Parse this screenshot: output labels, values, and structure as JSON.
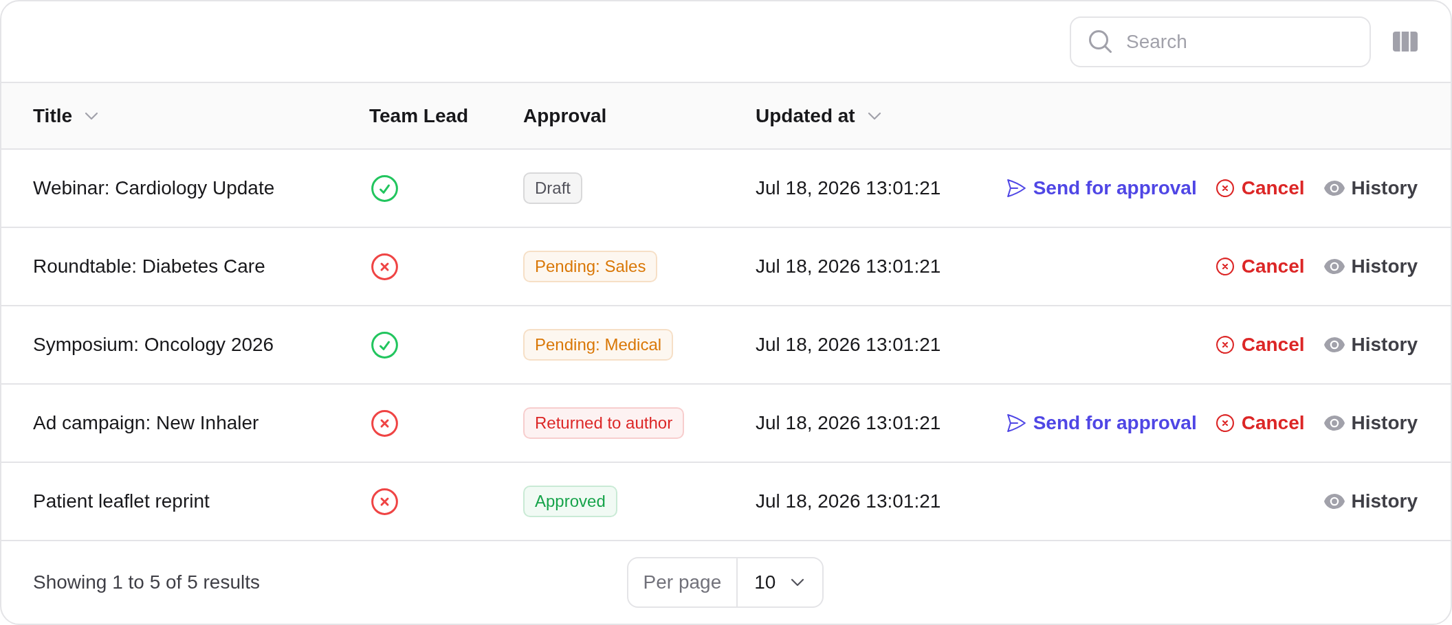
{
  "toolbar": {
    "search": {
      "placeholder": "Search"
    }
  },
  "table": {
    "columns": [
      {
        "label": "Title",
        "sortable": true
      },
      {
        "label": "Team Lead",
        "sortable": false
      },
      {
        "label": "Approval",
        "sortable": false
      },
      {
        "label": "Updated at",
        "sortable": true
      }
    ],
    "rows": [
      {
        "title": "Webinar: Cardiology Update",
        "team_lead_ok": true,
        "approval": {
          "label": "Draft",
          "color": "#52525b"
        },
        "updated_at": "Jul 18, 2026 13:01:21",
        "actions": [
          {
            "kind": "send",
            "label": "Send for approval"
          },
          {
            "kind": "cancel",
            "label": "Cancel"
          },
          {
            "kind": "history",
            "label": "History"
          }
        ]
      },
      {
        "title": "Roundtable: Diabetes Care",
        "team_lead_ok": false,
        "approval": {
          "label": "Pending: Sales",
          "color": "#d97706"
        },
        "updated_at": "Jul 18, 2026 13:01:21",
        "actions": [
          {
            "kind": "cancel",
            "label": "Cancel"
          },
          {
            "kind": "history",
            "label": "History"
          }
        ]
      },
      {
        "title": "Symposium: Oncology 2026",
        "team_lead_ok": true,
        "approval": {
          "label": "Pending: Medical",
          "color": "#d97706"
        },
        "updated_at": "Jul 18, 2026 13:01:21",
        "actions": [
          {
            "kind": "cancel",
            "label": "Cancel"
          },
          {
            "kind": "history",
            "label": "History"
          }
        ]
      },
      {
        "title": "Ad campaign: New Inhaler",
        "team_lead_ok": false,
        "approval": {
          "label": "Returned to author",
          "color": "#dc2626"
        },
        "updated_at": "Jul 18, 2026 13:01:21",
        "actions": [
          {
            "kind": "send",
            "label": "Send for approval"
          },
          {
            "kind": "cancel",
            "label": "Cancel"
          },
          {
            "kind": "history",
            "label": "History"
          }
        ]
      },
      {
        "title": "Patient leaflet reprint",
        "team_lead_ok": false,
        "approval": {
          "label": "Approved",
          "color": "#16a34a"
        },
        "updated_at": "Jul 18, 2026 13:01:21",
        "actions": [
          {
            "kind": "history",
            "label": "History"
          }
        ]
      }
    ]
  },
  "footer": {
    "summary": "Showing 1 to 5 of 5 results",
    "per_page": {
      "label": "Per page",
      "value": "10"
    }
  }
}
